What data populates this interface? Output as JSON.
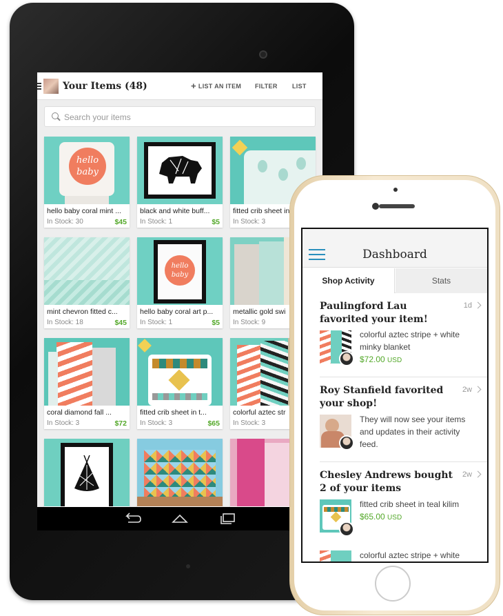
{
  "tablet": {
    "header": {
      "title": "Your Items (48)",
      "list_item_label": "LIST AN ITEM",
      "filter_label": "FILTER",
      "list_label": "LIST"
    },
    "search": {
      "placeholder": "Search your items"
    },
    "items": [
      {
        "name": "hello baby coral mint ...",
        "stock": "In Stock: 30",
        "price": "$45"
      },
      {
        "name": "black and white buff...",
        "stock": "In Stock: 1",
        "price": "$5"
      },
      {
        "name": "fitted crib sheet in",
        "stock": "In Stock: 3",
        "price": ""
      },
      {
        "name": "mint chevron fitted c...",
        "stock": "In Stock: 18",
        "price": "$45"
      },
      {
        "name": "hello baby coral art p...",
        "stock": "In Stock: 1",
        "price": "$5"
      },
      {
        "name": "metallic gold swi",
        "stock": "In Stock: 9",
        "price": ""
      },
      {
        "name": "coral diamond fall ...",
        "stock": "In Stock: 3",
        "price": "$72"
      },
      {
        "name": "fitted crib sheet in t...",
        "stock": "In Stock: 3",
        "price": "$65"
      },
      {
        "name": "colorful aztec str",
        "stock": "In Stock: 3",
        "price": ""
      }
    ],
    "product_image_text": "hello baby"
  },
  "phone": {
    "title": "Dashboard",
    "tabs": [
      "Shop Activity",
      "Stats"
    ],
    "activities": [
      {
        "heading": "Paulingford Lau favorited your item!",
        "time": "1d",
        "text": "colorful aztec stripe + white minky blanket",
        "price": "$72.00",
        "currency": "USD"
      },
      {
        "heading": "Roy Stanfield favorited your shop!",
        "time": "2w",
        "text": "They will now see your items and updates in their activity feed.",
        "price": "",
        "currency": ""
      },
      {
        "heading": "Chesley Andrews bought 2 of your items",
        "time": "2w",
        "text": "fitted crib sheet in teal kilim",
        "price": "$65.00",
        "currency": "USD"
      },
      {
        "heading": "",
        "time": "",
        "text": "colorful aztec stripe + white",
        "price": "",
        "currency": ""
      }
    ]
  },
  "colors": {
    "teal": "#6fcfc0",
    "coral": "#f07d5f",
    "price_green": "#53a829",
    "menu_blue": "#2a8fbd"
  }
}
